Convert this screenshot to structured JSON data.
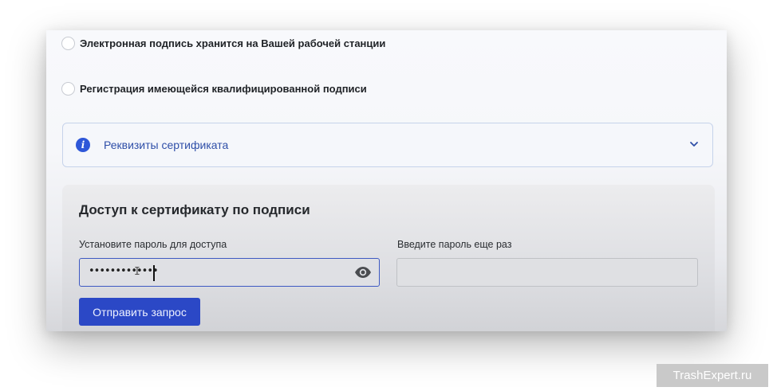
{
  "options": {
    "local_signature": "Электронная подпись хранится на Вашей рабочей станции",
    "register_qualified": "Регистрация имеющейся квалифицированной подписи"
  },
  "accordion": {
    "label": "Реквизиты сертификата",
    "icon": "info-icon",
    "chevron": "chevron-down-icon"
  },
  "access_panel": {
    "title": "Доступ к сертификату по подписи",
    "password_label": "Установите пароль для доступа",
    "password_value": "•••••••••••••",
    "repeat_label": "Введите пароль еще раз",
    "repeat_value": "",
    "submit_label": "Отправить запрос"
  },
  "watermark": "TrashExpert.ru",
  "colors": {
    "accent": "#2b48c6",
    "info": "#2e57d8",
    "accordion_text": "#2f4fa8"
  }
}
